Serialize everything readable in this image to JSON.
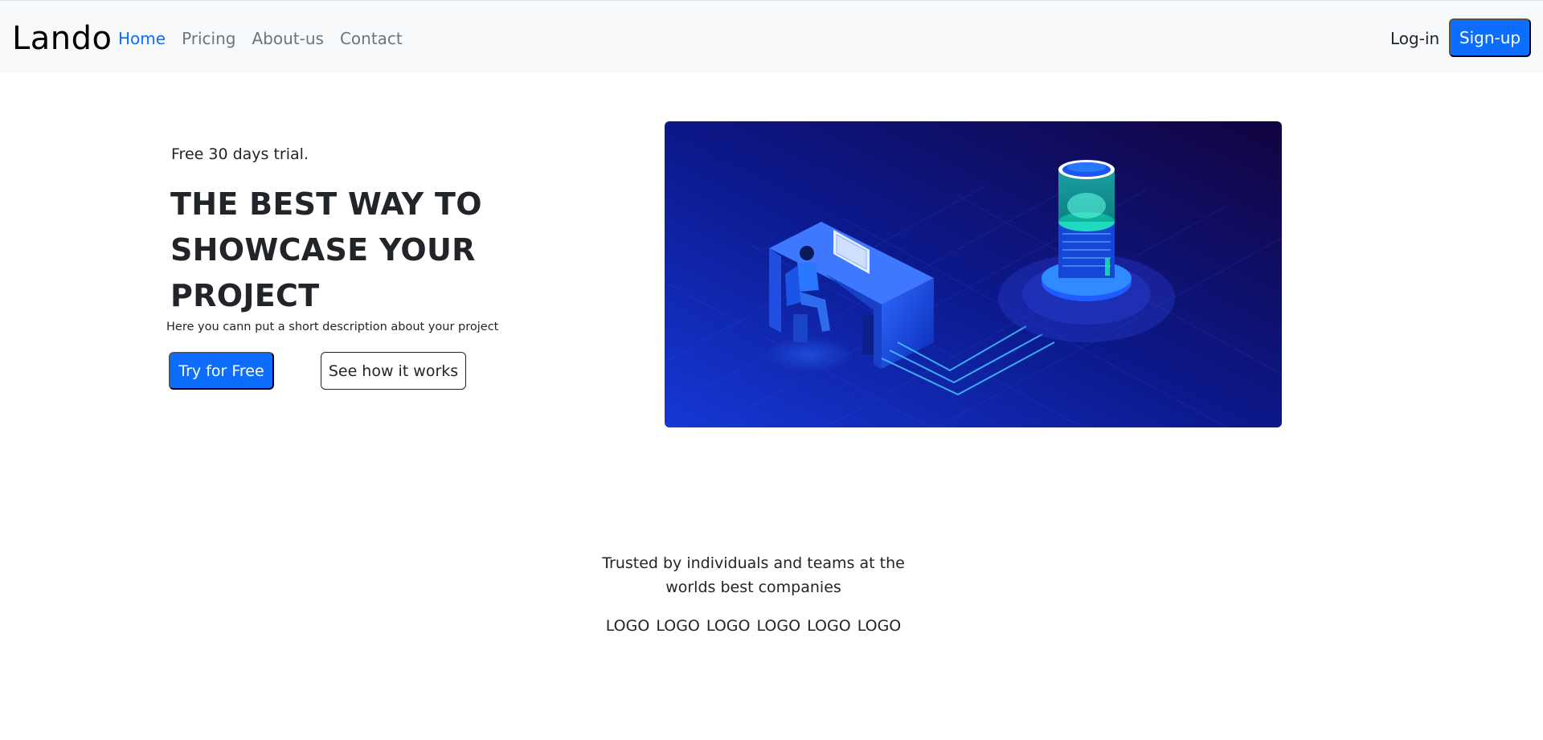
{
  "nav": {
    "brand": "Lando",
    "links": [
      {
        "label": "Home",
        "active": true
      },
      {
        "label": "Pricing",
        "active": false
      },
      {
        "label": "About-us",
        "active": false
      },
      {
        "label": "Contact",
        "active": false
      }
    ],
    "login_label": "Log-in",
    "signup_label": "Sign-up"
  },
  "hero": {
    "eyebrow": "Free 30 days trial.",
    "headline_lines": [
      "THE BEST WAY TO",
      "SHOWCASE YOUR",
      "PROJECT"
    ],
    "description": "Here you cann put a short description about your project",
    "primary_button": "Try for Free",
    "secondary_button": "See how it works",
    "illustration": "isometric-server-workstation-illustration"
  },
  "trusted": {
    "text": "Trusted by individuals and teams at the worlds best companies",
    "logos": [
      "LOGO",
      "LOGO",
      "LOGO",
      "LOGO",
      "LOGO",
      "LOGO"
    ]
  },
  "colors": {
    "primary": "#0d6efd",
    "navbar_bg": "#f8f9fa",
    "text": "#212529",
    "muted": "#6c757d"
  }
}
